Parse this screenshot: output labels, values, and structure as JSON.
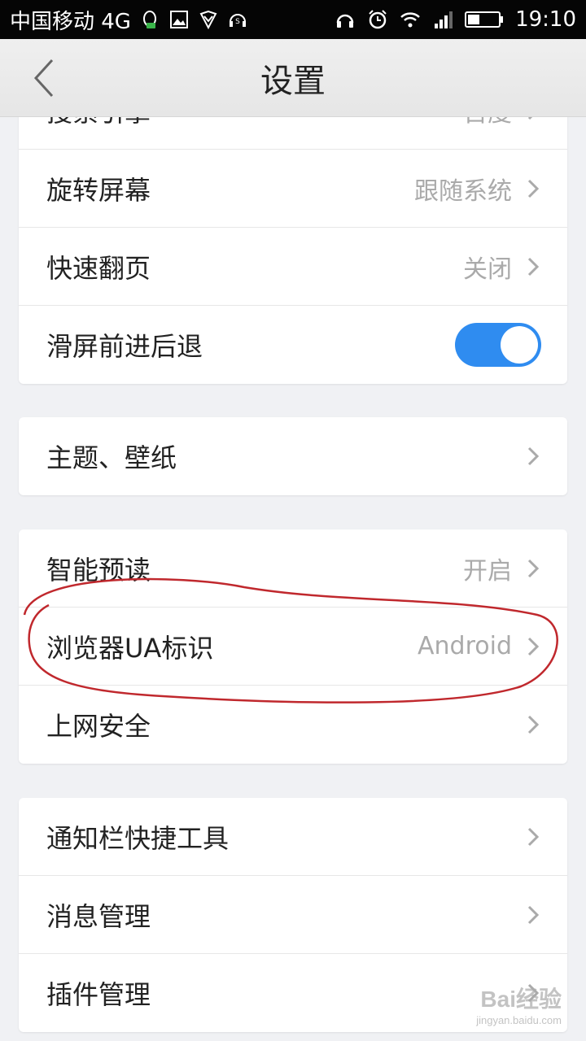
{
  "status_bar": {
    "carrier": "中国移动 4G",
    "time": "19:10",
    "left_icons": [
      "qq-icon",
      "image-icon",
      "shield-icon",
      "music-app-icon"
    ],
    "right_icons": [
      "headphones-icon",
      "alarm-icon",
      "wifi-icon",
      "signal-icon",
      "battery-icon"
    ]
  },
  "header": {
    "title": "设置",
    "back_icon": "chevron-left-icon"
  },
  "groups": [
    {
      "rows": [
        {
          "label": "搜索引擎",
          "value": "百度",
          "type": "link"
        },
        {
          "label": "旋转屏幕",
          "value": "跟随系统",
          "type": "link"
        },
        {
          "label": "快速翻页",
          "value": "关闭",
          "type": "link"
        },
        {
          "label": "滑屏前进后退",
          "value": "",
          "type": "toggle",
          "toggle_on": true
        }
      ]
    },
    {
      "rows": [
        {
          "label": "主题、壁纸",
          "value": "",
          "type": "link"
        }
      ]
    },
    {
      "rows": [
        {
          "label": "智能预读",
          "value": "开启",
          "type": "link"
        },
        {
          "label": "浏览器UA标识",
          "value": "Android",
          "type": "link"
        },
        {
          "label": "上网安全",
          "value": "",
          "type": "link"
        }
      ]
    },
    {
      "rows": [
        {
          "label": "通知栏快捷工具",
          "value": "",
          "type": "link"
        },
        {
          "label": "消息管理",
          "value": "",
          "type": "link"
        },
        {
          "label": "插件管理",
          "value": "",
          "type": "link"
        }
      ]
    }
  ],
  "colors": {
    "toggle_on": "#2f8cf0",
    "annotation": "#c0282d",
    "background": "#f0f1f4"
  },
  "watermark": {
    "brand": "Bai经验",
    "url": "jingyan.baidu.com"
  }
}
